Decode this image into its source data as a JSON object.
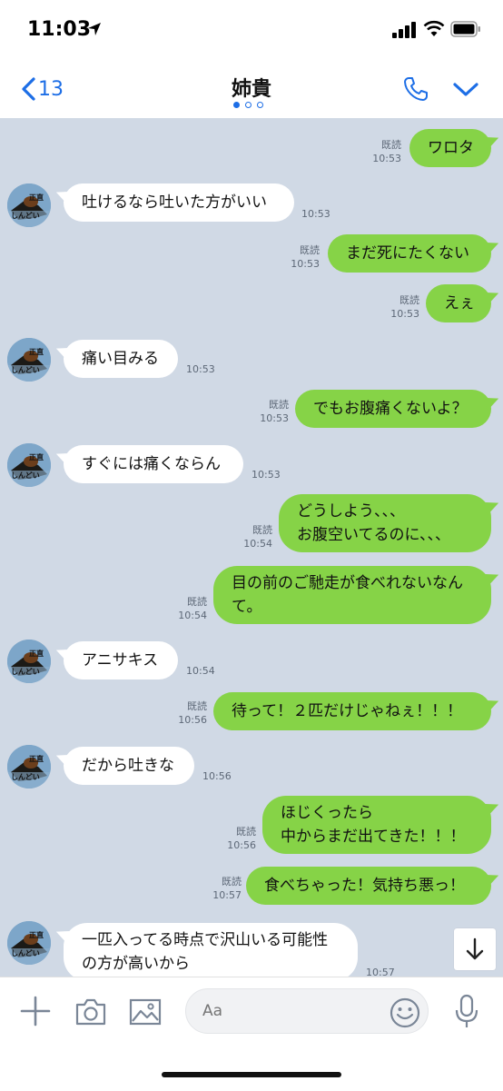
{
  "status": {
    "time": "11:03"
  },
  "header": {
    "back_count": "13",
    "title": "姉貴"
  },
  "messages": [
    {
      "text": "ワロタ",
      "read": "既読",
      "time": "10:53"
    },
    {
      "text": "吐けるなら吐いた方がいい",
      "time": "10:53"
    },
    {
      "text": "まだ死にたくない",
      "read": "既読",
      "time": "10:53"
    },
    {
      "text": "えぇ",
      "read": "既読",
      "time": "10:53"
    },
    {
      "text": "痛い目みる",
      "time": "10:53"
    },
    {
      "text": "でもお腹痛くないよ？",
      "read": "既読",
      "time": "10:53"
    },
    {
      "text": "すぐには痛くならん",
      "time": "10:53"
    },
    {
      "line1": "どうしよう、、、",
      "line2": "お腹空いてるのに、、、",
      "read": "既読",
      "time": "10:54"
    },
    {
      "line1": "目の前のご馳走が食べれないなん",
      "line2": "て。",
      "read": "既読",
      "time": "10:54"
    },
    {
      "text": "アニサキス",
      "time": "10:54"
    },
    {
      "text": "待って！２匹だけじゃねぇ！！！",
      "read": "既読",
      "time": "10:56"
    },
    {
      "text": "だから吐きな",
      "time": "10:56"
    },
    {
      "line1": "ほじくったら",
      "line2": "中からまだ出てきた！！！",
      "read": "既読",
      "time": "10:56"
    },
    {
      "text": "食べちゃった！気持ち悪っ！",
      "read": "既読",
      "time": "10:57"
    },
    {
      "line1": "一匹入ってる時点で沢山いる可能性",
      "line2": "の方が高いから",
      "time": "10:57"
    }
  ],
  "avatar": {
    "line1": "正直",
    "line2": "しんどい"
  },
  "input": {
    "placeholder": "Aa"
  },
  "colors": {
    "sent_bubble": "#86d347",
    "received_bubble": "#ffffff",
    "chat_background": "#d0d9e5",
    "accent": "#1d6ee6"
  },
  "icons": [
    "location-arrow-icon",
    "signal-icon",
    "wifi-icon",
    "battery-icon",
    "back-chevron-icon",
    "phone-icon",
    "chevron-down-icon",
    "arrow-down-icon",
    "plus-icon",
    "camera-icon",
    "image-icon",
    "emoji-icon",
    "microphone-icon"
  ]
}
